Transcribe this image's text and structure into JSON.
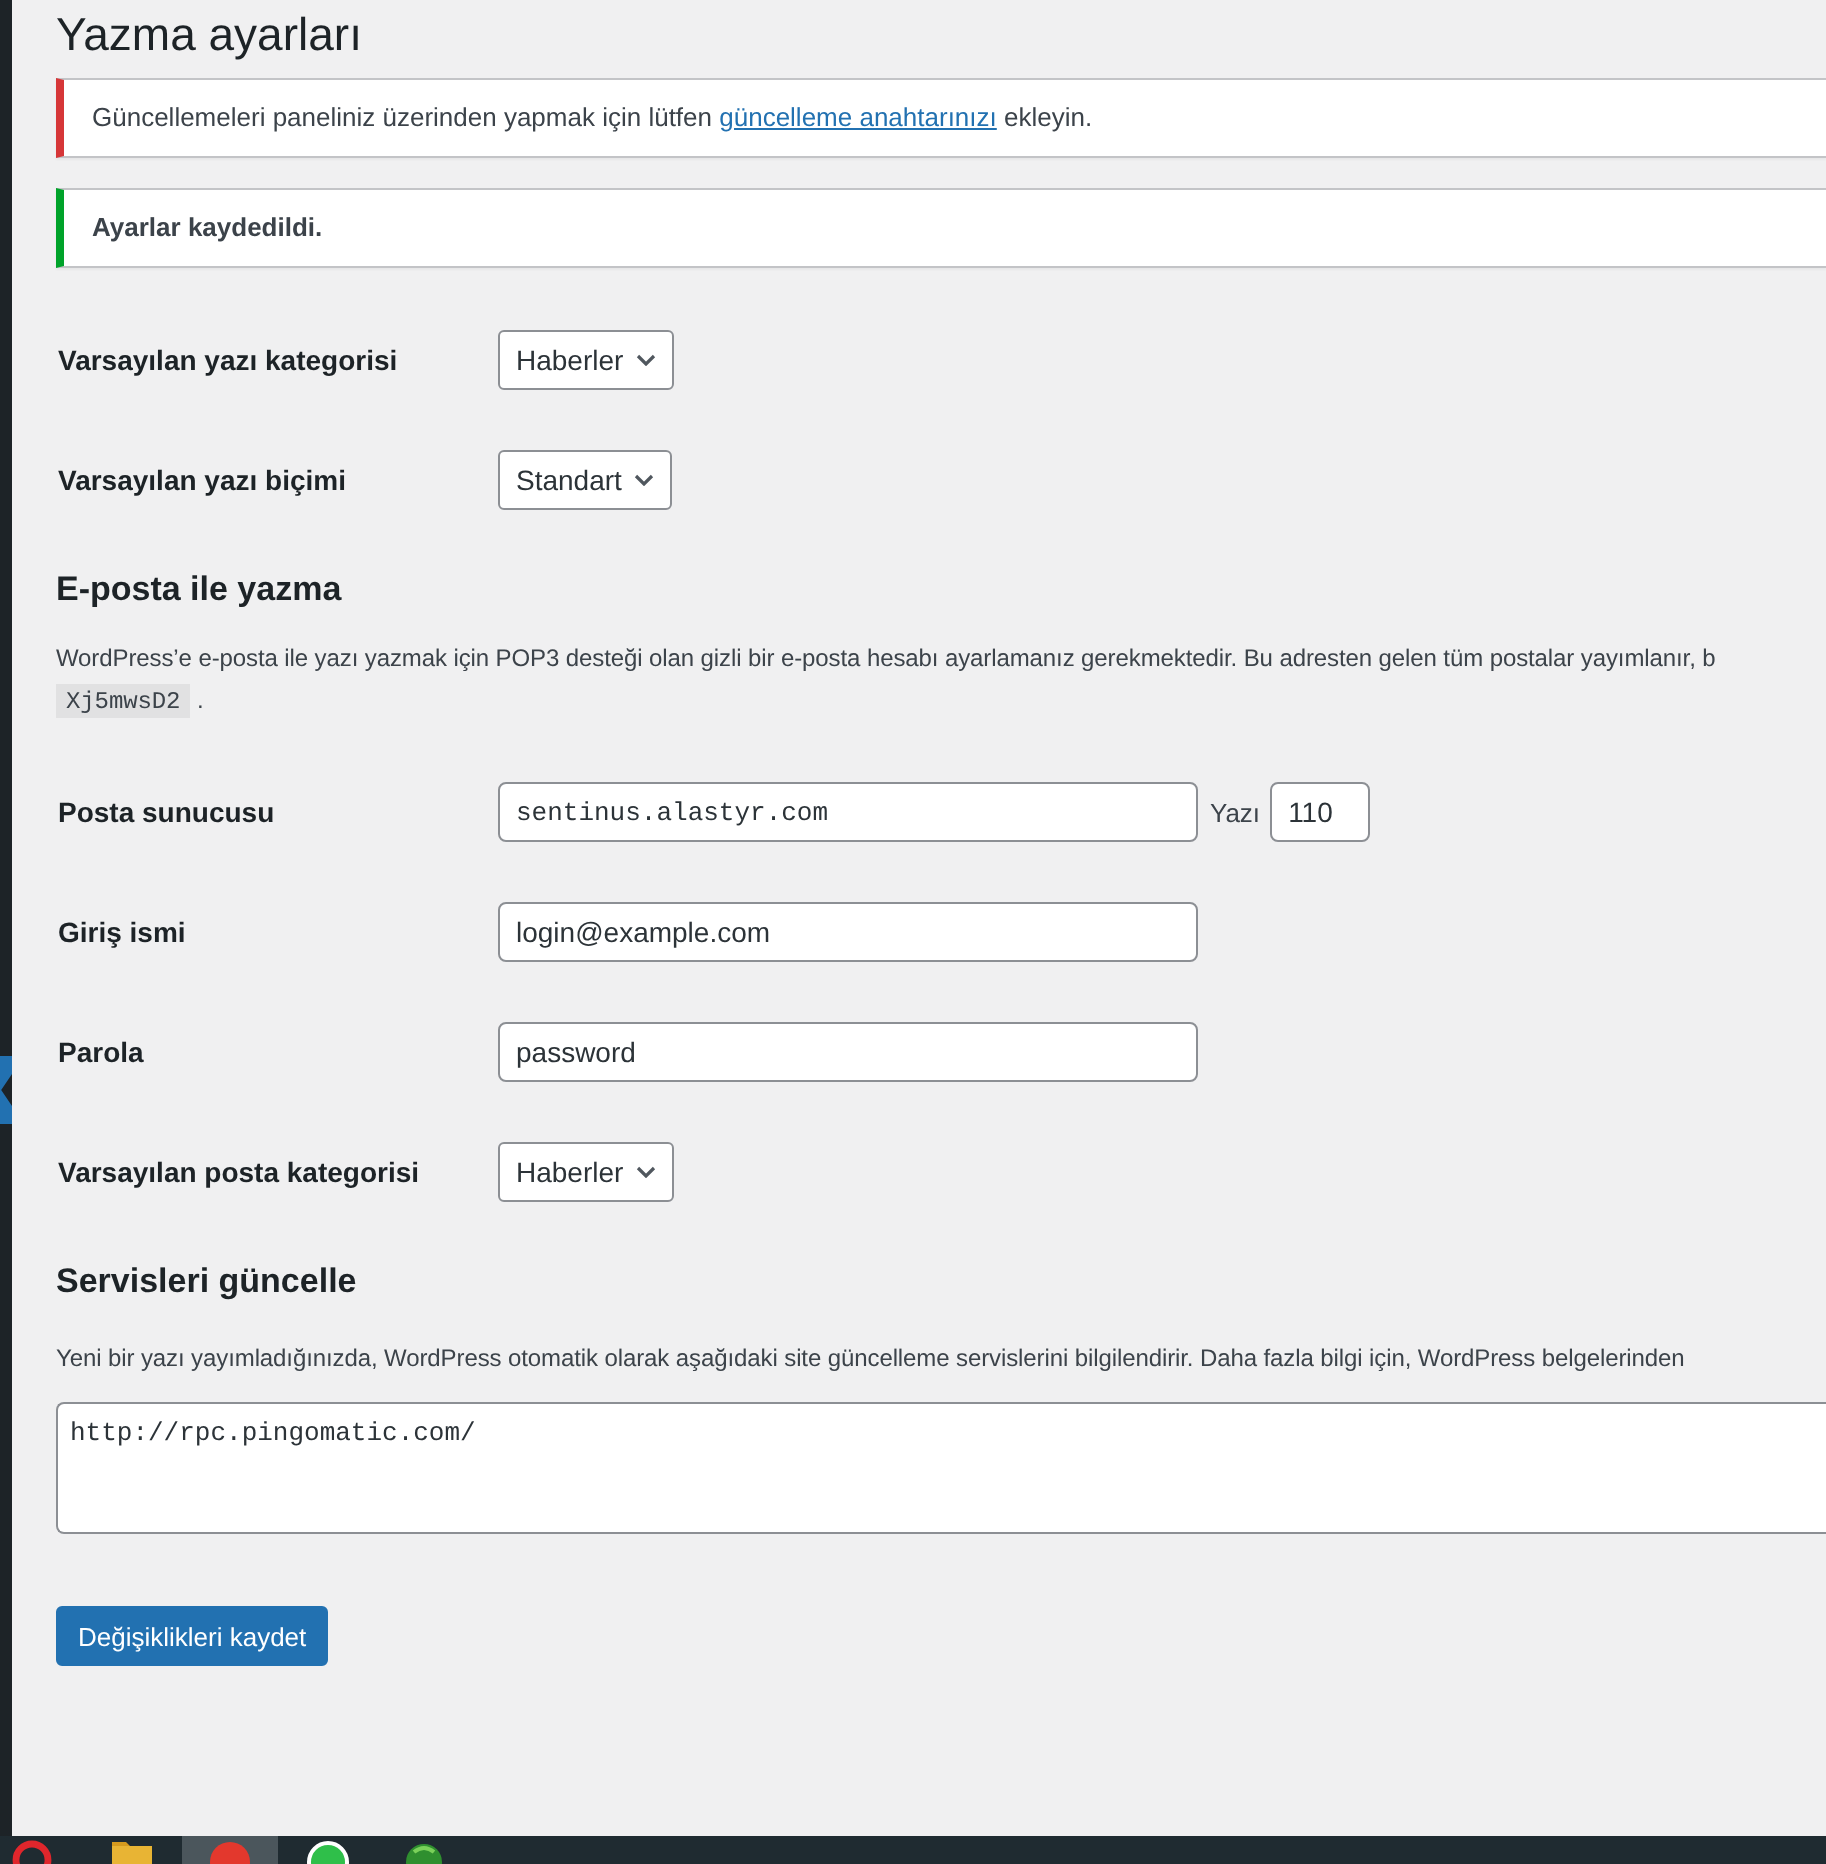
{
  "page": {
    "title": "Yazma ayarları"
  },
  "notices": [
    {
      "kind": "error",
      "text": "Güncellemeleri paneliniz üzerinden yapmak için lütfen ",
      "link": "güncelleme anahtarınızı",
      "text_after": " ekleyin."
    },
    {
      "kind": "success",
      "text": "Ayarlar kaydedildi."
    }
  ],
  "writing_defaults": [
    {
      "label": "Varsayılan yazı kategorisi",
      "kind": "select",
      "value": "Haberler"
    },
    {
      "label": "Varsayılan yazı biçimi",
      "kind": "select",
      "value": "Standart"
    }
  ],
  "post_via_email": {
    "heading": "E-posta ile yazma",
    "description": "WordPress’e e-posta ile yazı yazmak için POP3 desteği olan gizli bir e-posta hesabı ayarlamanız gerekmektedir. Bu adresten gelen tüm postalar yayımlanır, b",
    "code": "Xj5mwsD2",
    "description_end": ".",
    "fields": [
      {
        "label": "Posta sunucusu",
        "kind": "server",
        "value": "sentinus.alastyr.com",
        "port_label": "Yazı",
        "port": "110"
      },
      {
        "label": "Giriş ismi",
        "kind": "text",
        "value": "login@example.com"
      },
      {
        "label": "Parola",
        "kind": "text",
        "value": "password"
      },
      {
        "label": "Varsayılan posta kategorisi",
        "kind": "select",
        "value": "Haberler"
      }
    ]
  },
  "update_services": {
    "heading": "Servisleri güncelle",
    "description": "Yeni bir yazı yayımladığınızda, WordPress otomatik olarak aşağıdaki site güncelleme servislerini bilgilendirir. Daha fazla bilgi için, WordPress belgelerinden",
    "services": "http://rpc.pingomatic.com/"
  },
  "save_button": "Değişiklikleri kaydet",
  "taskbar": {
    "apps": [
      {
        "kind": "ring",
        "selected": false
      },
      {
        "kind": "folder",
        "selected": false
      },
      {
        "kind": "disc",
        "selected": true
      },
      {
        "kind": "bubble",
        "selected": false
      },
      {
        "kind": "orb",
        "selected": false
      }
    ]
  }
}
